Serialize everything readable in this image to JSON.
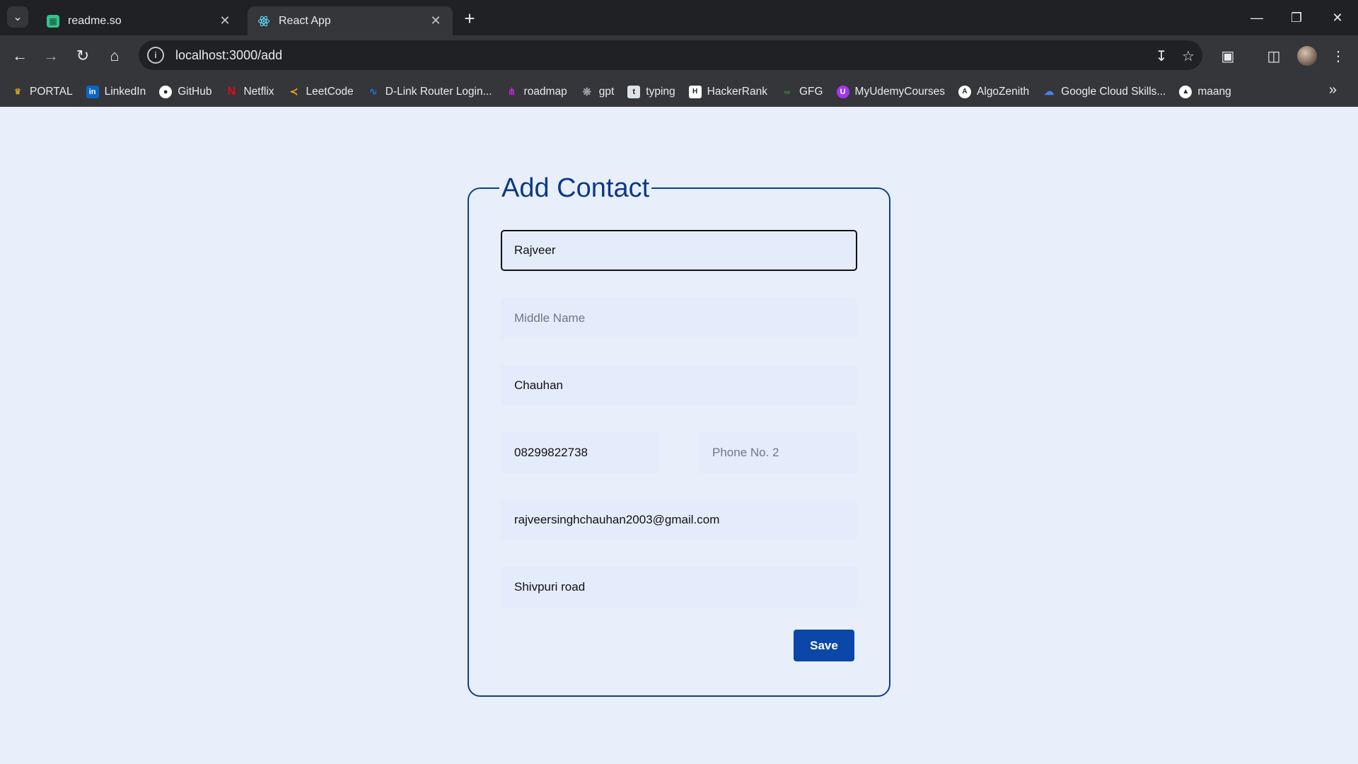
{
  "browser": {
    "tabs": [
      {
        "title": "readme.so",
        "active": false,
        "icon": "readme-favicon"
      },
      {
        "title": "React App",
        "active": true,
        "icon": "react-favicon"
      }
    ],
    "url": "localhost:3000/add",
    "bookmarks": [
      {
        "label": "PORTAL",
        "icon": "portal-icon",
        "color": "#c9a227"
      },
      {
        "label": "LinkedIn",
        "icon": "linkedin-icon",
        "color": "#0a66c2"
      },
      {
        "label": "GitHub",
        "icon": "github-icon",
        "color": "#ffffff"
      },
      {
        "label": "Netflix",
        "icon": "netflix-icon",
        "color": "#e50914"
      },
      {
        "label": "LeetCode",
        "icon": "leetcode-icon",
        "color": "#ffa116"
      },
      {
        "label": "D-Link Router Login...",
        "icon": "dlink-icon",
        "color": "#1a73e8"
      },
      {
        "label": "roadmap",
        "icon": "roadmap-icon",
        "color": "#c026d3"
      },
      {
        "label": "gpt",
        "icon": "gpt-icon",
        "color": "#9aa0a6"
      },
      {
        "label": "typing",
        "icon": "typing-icon",
        "color": "#dfe3e8"
      },
      {
        "label": "HackerRank",
        "icon": "hackerrank-icon",
        "color": "#ffffff"
      },
      {
        "label": "GFG",
        "icon": "gfg-icon",
        "color": "#2f8d46"
      },
      {
        "label": "MyUdemyCourses",
        "icon": "udemy-icon",
        "color": "#a435f0"
      },
      {
        "label": "AlgoZenith",
        "icon": "algozenith-icon",
        "color": "#ffffff"
      },
      {
        "label": "Google Cloud Skills...",
        "icon": "google-cloud-icon",
        "color": "#4285f4"
      },
      {
        "label": "maang",
        "icon": "maang-icon",
        "color": "#ffffff"
      }
    ]
  },
  "form": {
    "title": "Add Contact",
    "first_name": {
      "value": "Rajveer",
      "placeholder": ""
    },
    "middle_name": {
      "value": "",
      "placeholder": "Middle Name"
    },
    "last_name": {
      "value": "Chauhan",
      "placeholder": ""
    },
    "phone1": {
      "value": "08299822738",
      "placeholder": ""
    },
    "phone2": {
      "value": "",
      "placeholder": "Phone No. 2"
    },
    "email": {
      "value": "rajveersinghchauhan2003@gmail.com",
      "placeholder": ""
    },
    "address": {
      "value": "Shivpuri road",
      "placeholder": ""
    },
    "save_label": "Save"
  },
  "colors": {
    "page_background": "#e8effb",
    "accent": "#0b47a8",
    "title": "#0d3a85"
  }
}
